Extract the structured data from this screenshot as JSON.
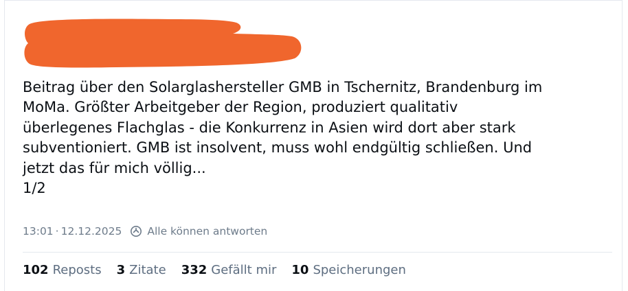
{
  "post": {
    "text": "Beitrag über den Solarglashersteller GMB in Tschernitz, Brandenburg im\nMoMa. Größter Arbeitgeber der Region, produziert qualitativ\nüberlegenes Flachglas - die Konkurrenz in Asien wird dort aber stark\nsubventioniert. GMB ist insolvent, muss wohl endgültig schließen. Und\njetzt das für mich völlig...\n1/2",
    "time": "13:01",
    "separator": "·",
    "date": "12.12.2025",
    "reply_setting": {
      "icon": "reply-restriction-icon",
      "label": "Alle können antworten"
    }
  },
  "stats": [
    {
      "count": "102",
      "label": "Reposts"
    },
    {
      "count": "3",
      "label": "Zitate"
    },
    {
      "count": "332",
      "label": "Gefällt mir"
    },
    {
      "count": "10",
      "label": "Speicherungen"
    }
  ],
  "colors": {
    "redaction": "#f0662d",
    "text": "#0b0f14",
    "muted": "#6d7b8a",
    "divider": "#e4e8ee"
  }
}
